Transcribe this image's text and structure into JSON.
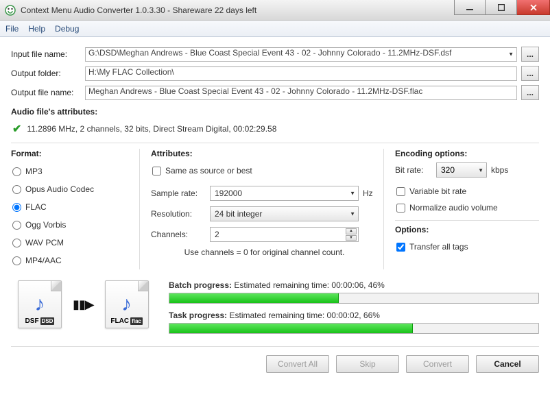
{
  "window": {
    "title": "Context Menu Audio Converter 1.0.3.30 - Shareware 22 days left"
  },
  "menu": {
    "file": "File",
    "help": "Help",
    "debug": "Debug"
  },
  "fields": {
    "input_label": "Input file name:",
    "input_value": "G:\\DSD\\Meghan Andrews - Blue Coast Special Event 43 - 02 - Johnny Colorado - 11.2MHz-DSF.dsf",
    "outfolder_label": "Output folder:",
    "outfolder_value": "H:\\My FLAC Collection\\",
    "outfile_label": "Output file name:",
    "outfile_value": "Meghan Andrews - Blue Coast Special Event 43 - 02 - Johnny Colorado - 11.2MHz-DSF.flac",
    "browse": "..."
  },
  "audio_attr": {
    "header": "Audio file's attributes:",
    "text": "11.2896 MHz, 2 channels, 32 bits, Direct Stream Digital, 00:02:29.58"
  },
  "format": {
    "header": "Format:",
    "options": [
      "MP3",
      "Opus Audio Codec",
      "FLAC",
      "Ogg Vorbis",
      "WAV PCM",
      "MP4/AAC"
    ],
    "selected": "FLAC"
  },
  "attributes": {
    "header": "Attributes:",
    "same_as_source": "Same as source or best",
    "sample_rate_label": "Sample rate:",
    "sample_rate_value": "192000",
    "sample_rate_unit": "Hz",
    "resolution_label": "Resolution:",
    "resolution_value": "24 bit integer",
    "channels_label": "Channels:",
    "channels_value": "2",
    "channels_hint": "Use channels = 0 for original channel count."
  },
  "encoding": {
    "header": "Encoding options:",
    "bitrate_label": "Bit rate:",
    "bitrate_value": "320",
    "bitrate_unit": "kbps",
    "vbr": "Variable bit rate",
    "normalize": "Normalize audio volume"
  },
  "options": {
    "header": "Options:",
    "transfer_tags": "Transfer all tags"
  },
  "icons": {
    "src_ext_a": "DSF",
    "src_ext_b": "DSD",
    "dst_ext_a": "FLAC",
    "dst_ext_b": "flac"
  },
  "progress": {
    "batch_label": "Batch progress:",
    "batch_text": "Estimated remaining time: 00:00:06, 46%",
    "batch_pct": 46,
    "task_label": "Task progress:",
    "task_text": "Estimated remaining time: 00:00:02, 66%",
    "task_pct": 66
  },
  "buttons": {
    "convert_all": "Convert All",
    "skip": "Skip",
    "convert": "Convert",
    "cancel": "Cancel"
  }
}
